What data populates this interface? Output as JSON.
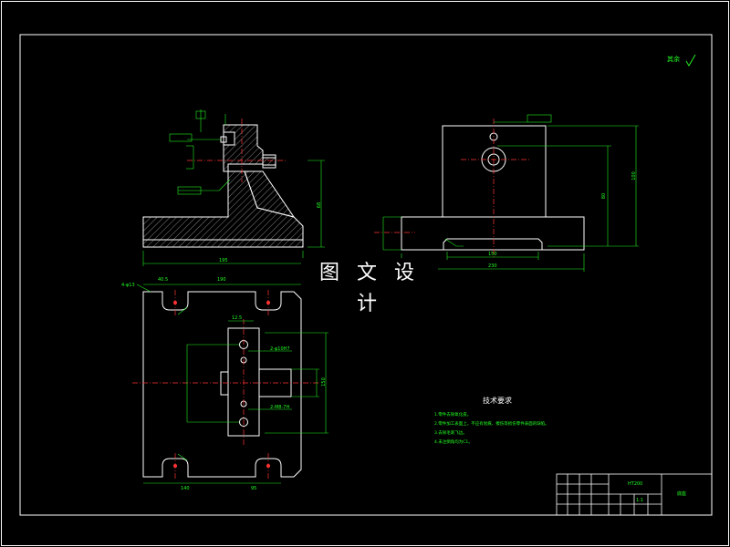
{
  "watermark": "图 文 设 计",
  "roughness_note": "其余",
  "technical_requirements": {
    "title": "技术要求",
    "items": [
      "1.零件去除氧化皮。",
      "2.零件加工表面上，不应有划痕、擦伤等损伤零件表面的缺陷。",
      "3.去除毛刺飞边。",
      "4.未注倒角均为C1。"
    ]
  },
  "dimensions": {
    "front_width": "195",
    "front_height": "68",
    "side_height_outer": "100",
    "side_height_inner": "80",
    "side_base_width": "230",
    "side_slot_width": "150",
    "top_left_slot": "40.5",
    "top_center": "190",
    "top_hole_label": "4-φ13",
    "top_height": "150",
    "bottom_left": "140",
    "bottom_right": "95",
    "callout_a": "2-φ10H7",
    "callout_b": "2-M8-7H",
    "callout_c": "12.5"
  },
  "title_block": {
    "part_name": "底座",
    "material": "HT200",
    "scale": "1:1"
  },
  "colors": {
    "outline": "#ffffff",
    "dimension": "#22ee22",
    "center_line": "#ff3333",
    "hatch": "#dddddd",
    "frame": "#ffffff"
  }
}
